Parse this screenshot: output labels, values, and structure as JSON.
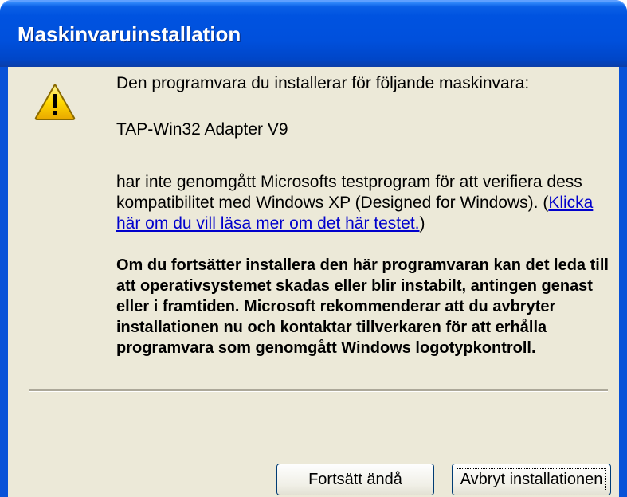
{
  "window": {
    "title": "Maskinvaruinstallation"
  },
  "content": {
    "intro": "Den programvara du installerar för följande maskinvara:",
    "device": "TAP-Win32 Adapter V9",
    "text_before_link": "har inte genomgått Microsofts testprogram för att verifiera dess kompatibilitet med Windows XP (Designed for Windows). (",
    "link_text": "Klicka här om du vill läsa mer om det här testet.",
    "text_after_link": ")",
    "warning": "Om du fortsätter installera den här programvaran kan det leda till att operativsystemet skadas eller blir instabilt, antingen genast eller i framtiden. Microsoft rekommenderar att du avbryter installationen nu och kontaktar tillverkaren för att erhålla programvara som genomgått Windows logotypkontroll."
  },
  "buttons": {
    "continue": "Fortsätt ändå",
    "cancel": "Avbryt installationen"
  },
  "icons": {
    "warning": "warning-icon"
  }
}
